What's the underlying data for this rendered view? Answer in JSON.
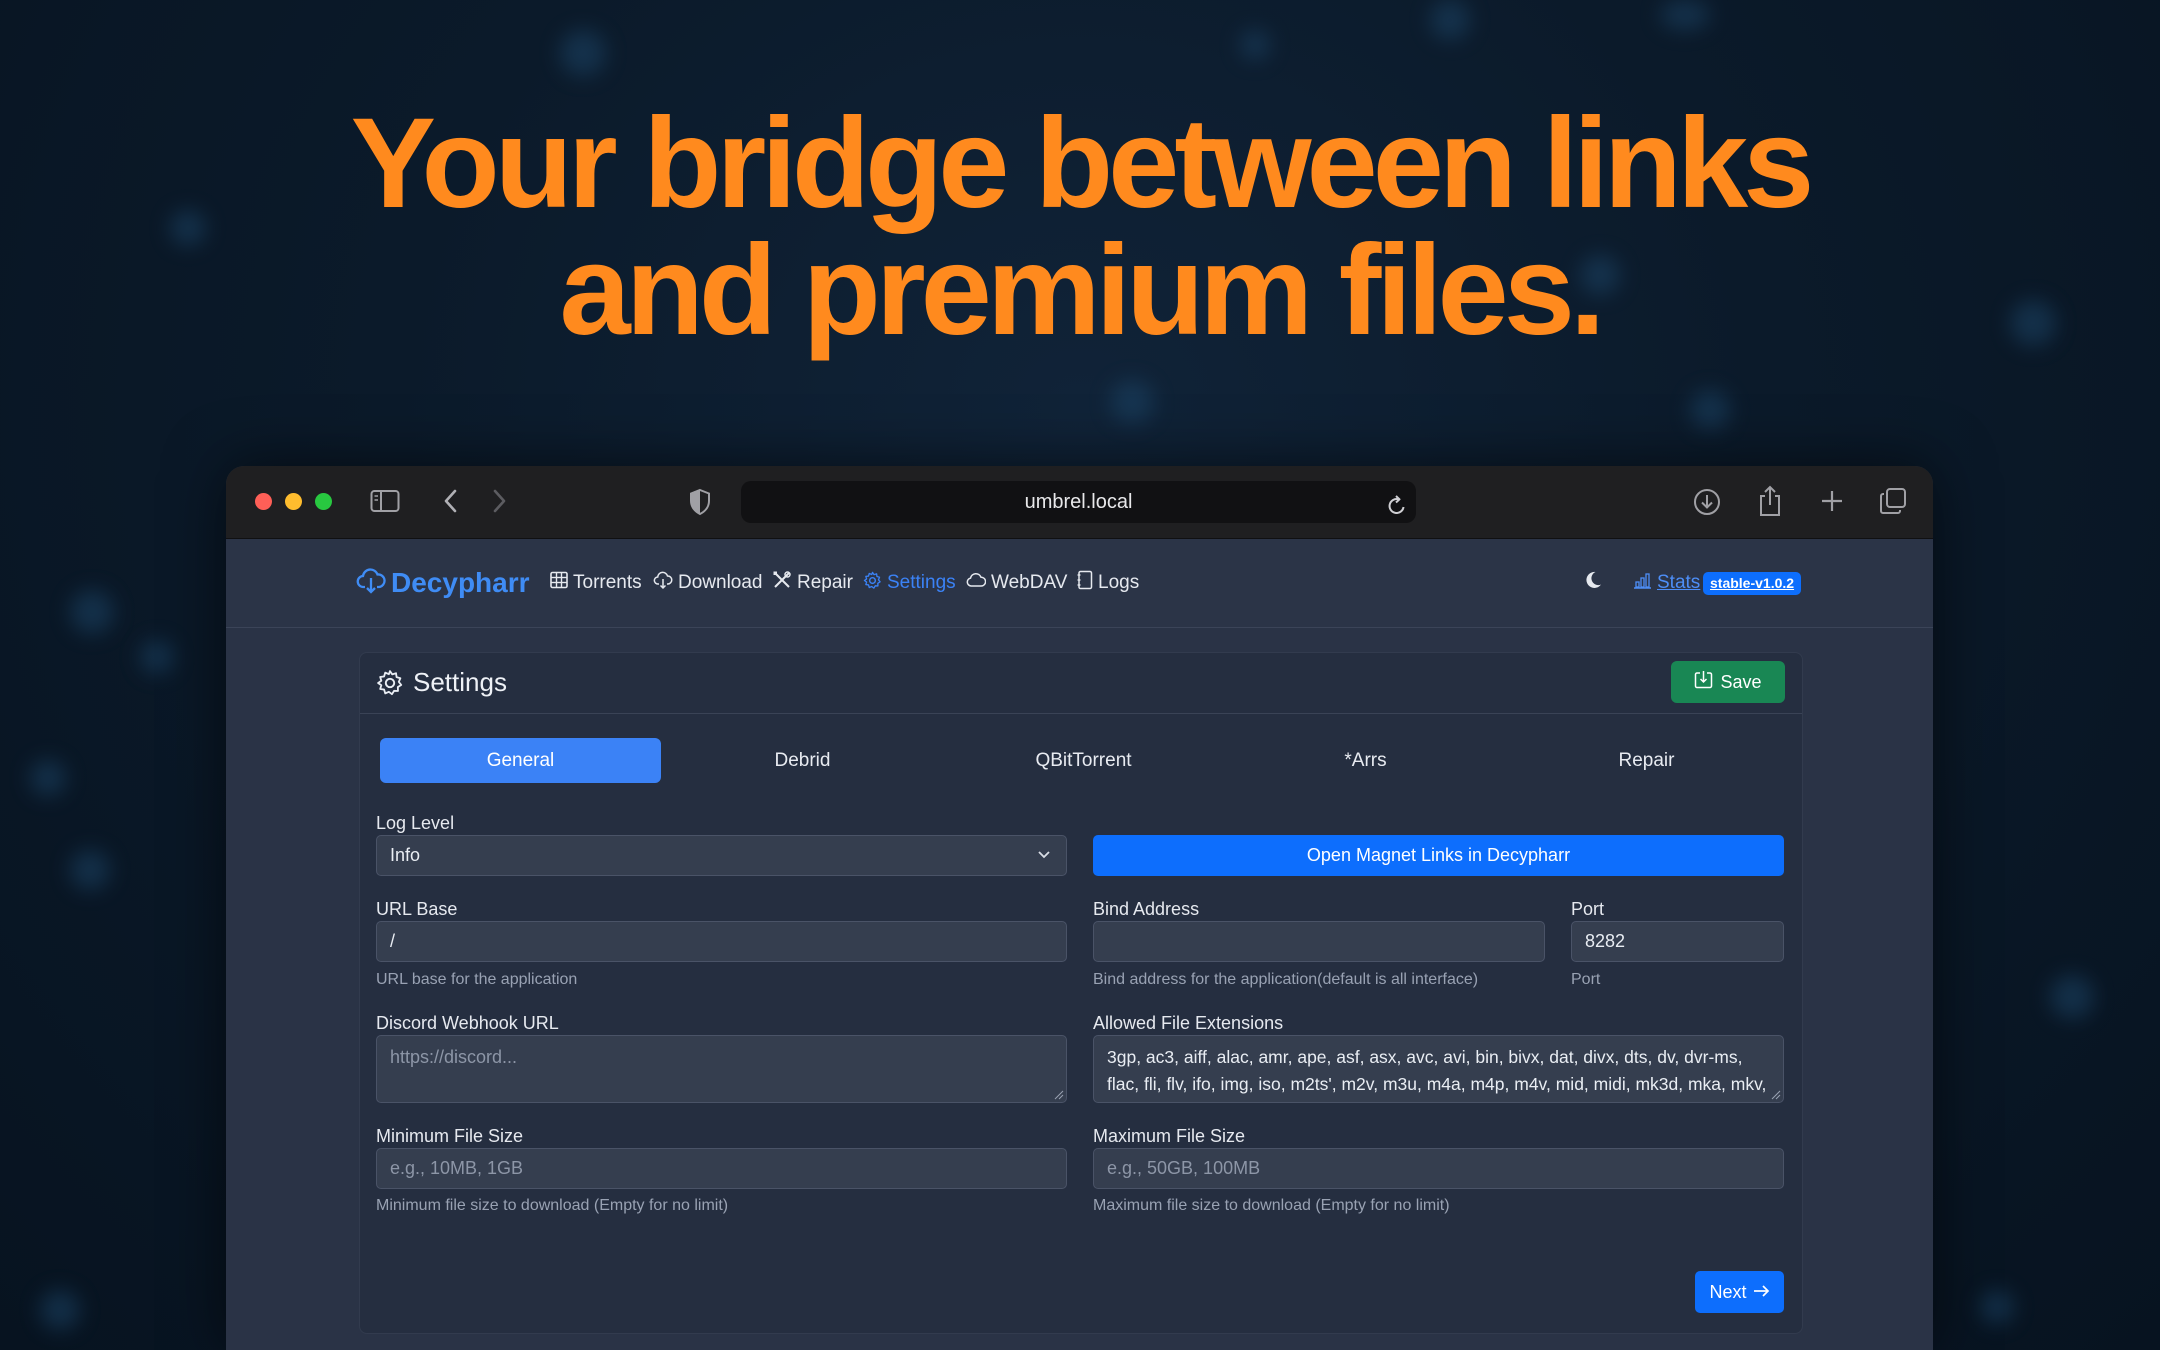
{
  "hero": {
    "line1": "Your bridge between links",
    "line2": "and premium files."
  },
  "browser": {
    "url": "umbrel.local",
    "icons": [
      "sidebar-icon",
      "back-icon",
      "forward-icon",
      "privacy-shield-icon",
      "reload-icon",
      "download-icon",
      "share-icon",
      "new-tab-icon",
      "tabs-overview-icon"
    ]
  },
  "nav": {
    "brand": "Decypharr",
    "items": [
      {
        "label": "Torrents",
        "icon": "table-icon"
      },
      {
        "label": "Download",
        "icon": "cloud-download-icon"
      },
      {
        "label": "Repair",
        "icon": "tools-icon"
      },
      {
        "label": "Settings",
        "icon": "gear-icon",
        "active": true
      },
      {
        "label": "WebDAV",
        "icon": "cloud-icon"
      },
      {
        "label": "Logs",
        "icon": "journal-icon"
      }
    ],
    "stats_label": "Stats",
    "version_badge": "stable-v1.0.2",
    "theme_icon": "moon-icon"
  },
  "settings": {
    "title": "Settings",
    "save_label": "Save",
    "tabs": [
      "General",
      "Debrid",
      "QBitTorrent",
      "*Arrs",
      "Repair"
    ],
    "active_tab": "General",
    "log_level": {
      "label": "Log Level",
      "value": "Info"
    },
    "open_magnet_label": "Open Magnet Links in Decypharr",
    "url_base": {
      "label": "URL Base",
      "value": "/",
      "help": "URL base for the application"
    },
    "bind_address": {
      "label": "Bind Address",
      "value": "",
      "help": "Bind address for the application(default is all interface)"
    },
    "port": {
      "label": "Port",
      "value": "8282",
      "help": "Port"
    },
    "discord_webhook": {
      "label": "Discord Webhook URL",
      "placeholder": "https://discord..."
    },
    "allowed_extensions": {
      "label": "Allowed File Extensions",
      "value": "3gp, ac3, aiff, alac, amr, ape, asf, asx, avc, avi, bin, bivx, dat, divx, dts, dv, dvr-ms, flac, fli, flv, ifo, img, iso, m2ts', m2v, m3u, m4a, m4p, m4v, mid, midi, mk3d, mka, mkv,"
    },
    "min_file_size": {
      "label": "Minimum File Size",
      "placeholder": "e.g., 10MB, 1GB",
      "help": "Minimum file size to download (Empty for no limit)"
    },
    "max_file_size": {
      "label": "Maximum File Size",
      "placeholder": "e.g., 50GB, 100MB",
      "help": "Maximum file size to download (Empty for no limit)"
    },
    "next_label": "Next"
  },
  "colors": {
    "accent": "#ff8a1e",
    "primary": "#0d6efd",
    "success": "#198754",
    "nav_active": "#3b82f6"
  }
}
